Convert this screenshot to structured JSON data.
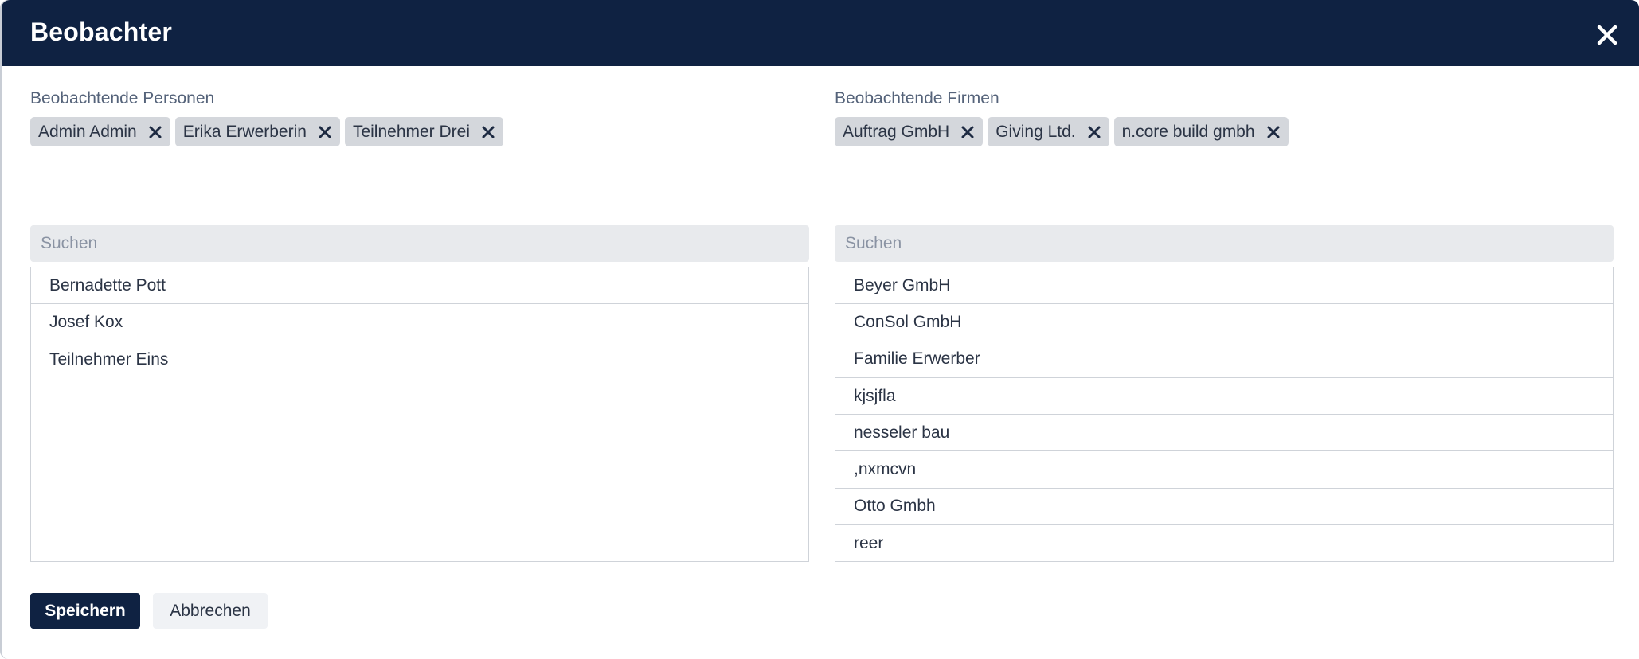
{
  "dialog": {
    "title": "Beobachter",
    "close_icon": "close-icon"
  },
  "persons": {
    "label": "Beobachtende Personen",
    "selected": [
      {
        "label": "Admin Admin"
      },
      {
        "label": "Erika Erwerberin"
      },
      {
        "label": "Teilnehmer Drei"
      }
    ],
    "search_placeholder": "Suchen",
    "options": [
      {
        "label": "Bernadette Pott"
      },
      {
        "label": "Josef Kox"
      },
      {
        "label": "Teilnehmer Eins"
      }
    ]
  },
  "companies": {
    "label": "Beobachtende Firmen",
    "selected": [
      {
        "label": "Auftrag GmbH"
      },
      {
        "label": "Giving Ltd."
      },
      {
        "label": "n.core build gmbh"
      }
    ],
    "search_placeholder": "Suchen",
    "options": [
      {
        "label": "Beyer GmbH"
      },
      {
        "label": "ConSol GmbH"
      },
      {
        "label": "Familie Erwerber"
      },
      {
        "label": "kjsjfla"
      },
      {
        "label": "nesseler bau"
      },
      {
        "label": ",nxmcvn"
      },
      {
        "label": "Otto Gmbh"
      },
      {
        "label": "reer"
      }
    ]
  },
  "footer": {
    "save_label": "Speichern",
    "cancel_label": "Abbrechen"
  },
  "colors": {
    "header_bg": "#0f2242",
    "chip_bg": "#d4d7dc",
    "search_bg": "#e8eaed",
    "primary_button": "#0f2242"
  }
}
